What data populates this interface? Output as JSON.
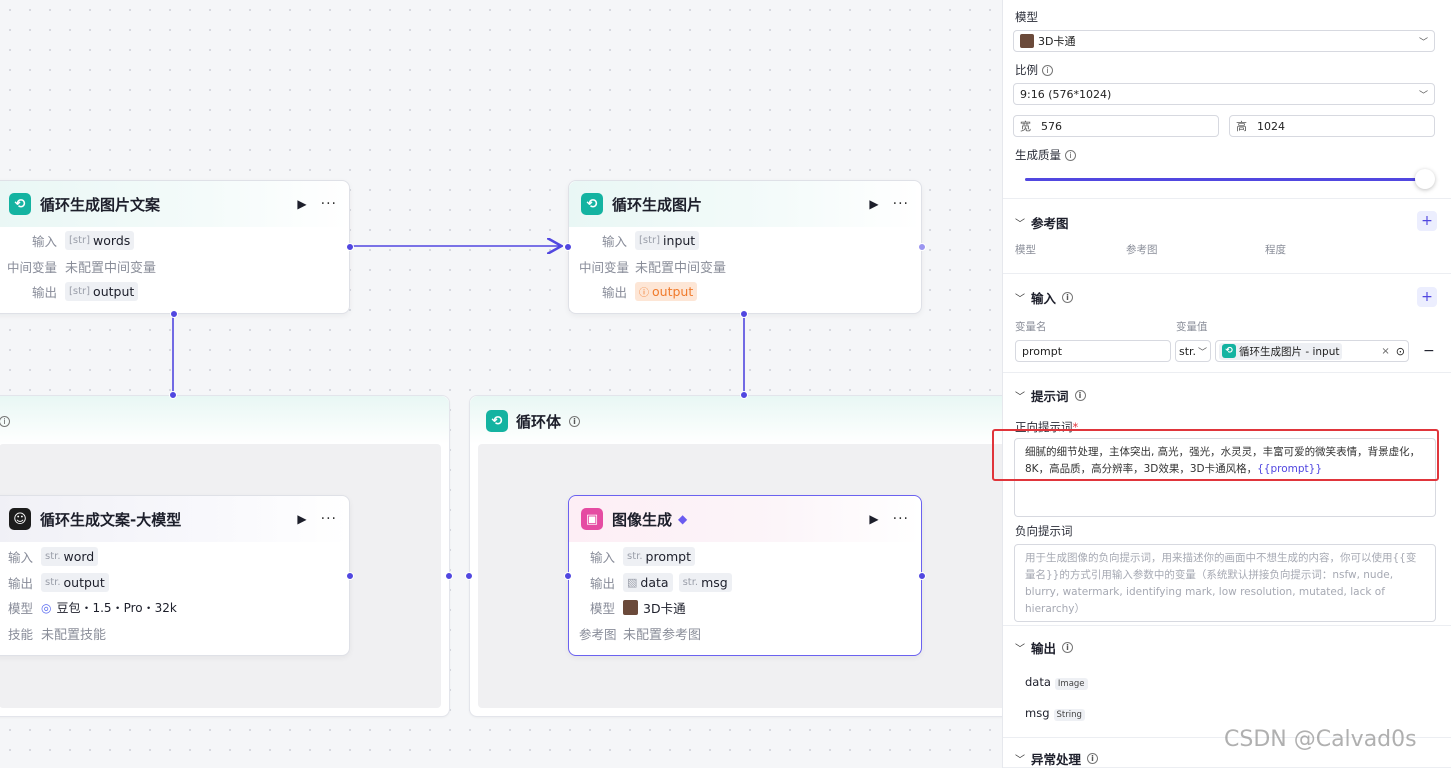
{
  "canvas": {
    "node_loop_text": {
      "title": "循环生成图片文案",
      "input_label": "输入",
      "input_type": "[str]",
      "input_value": "words",
      "mid_label": "中间变量",
      "mid_value": "未配置中间变量",
      "output_label": "输出",
      "output_type": "[str]",
      "output_value": "output"
    },
    "node_loop_image": {
      "title": "循环生成图片",
      "input_label": "输入",
      "input_type": "[str]",
      "input_value": "input",
      "mid_label": "中间变量",
      "mid_value": "未配置中间变量",
      "output_label": "输出",
      "output_type": "ⓘ",
      "output_value": "output"
    },
    "group_loop_body": {
      "title": "循环体"
    },
    "node_llm": {
      "title": "循环生成文案-大模型",
      "input_label": "输入",
      "input_type": "str.",
      "input_value": "word",
      "output_label": "输出",
      "output_type": "str.",
      "output_value": "output",
      "model_label": "模型",
      "model_value": "豆包・1.5・Pro・32k",
      "skill_label": "技能",
      "skill_value": "未配置技能"
    },
    "node_image_gen": {
      "title": "图像生成",
      "input_label": "输入",
      "input_type": "str.",
      "input_value": "prompt",
      "output_label": "输出",
      "output_value_1": "data",
      "output_type_2": "str.",
      "output_value_2": "msg",
      "model_label": "模型",
      "model_value": "3D卡通",
      "ref_label": "参考图",
      "ref_value": "未配置参考图"
    },
    "run_icon": "▶",
    "more_icon": "···"
  },
  "panel": {
    "model_label": "模型",
    "model_value": "3D卡通",
    "ratio_label": "比例",
    "ratio_value": "9:16 (576*1024)",
    "width_prefix": "宽",
    "width_value": "576",
    "height_prefix": "高",
    "height_value": "1024",
    "quality_label": "生成质量",
    "quality_level": 1.0,
    "ref_section": "参考图",
    "ref_cols": [
      "模型",
      "参考图",
      "程度"
    ],
    "input_section": "输入",
    "var_name_label": "变量名",
    "var_value_label": "变量值",
    "var_name": "prompt",
    "var_type": "str.",
    "var_ref": "循环生成图片 - input",
    "prompt_section": "提示词",
    "positive_label": "正向提示词",
    "required_mark": "*",
    "positive_text": "细腻的细节处理，主体突出, 高光，强光，水灵灵，丰富可爱的微笑表情，背景虚化，8K，高品质，高分辨率，3D效果，3D卡通风格，",
    "positive_var": "{{prompt}}",
    "negative_label": "负向提示词",
    "negative_placeholder": "用于生成图像的负向提示词，用来描述你的画面中不想生成的内容，你可以使用{{变量名}}的方式引用输入参数中的变量（系统默认拼接负向提示词：nsfw, nude, blurry, watermark, identifying mark, low resolution, mutated, lack of hierarchy）",
    "output_section": "输出",
    "outputs": [
      {
        "name": "data",
        "type": "Image"
      },
      {
        "name": "msg",
        "type": "String"
      }
    ],
    "error_section": "异常处理"
  },
  "watermark": "CSDN @Calvad0s",
  "colors": {
    "accent": "#5147e0",
    "teal": "#14b3a1",
    "highlight": "#e0353b"
  }
}
